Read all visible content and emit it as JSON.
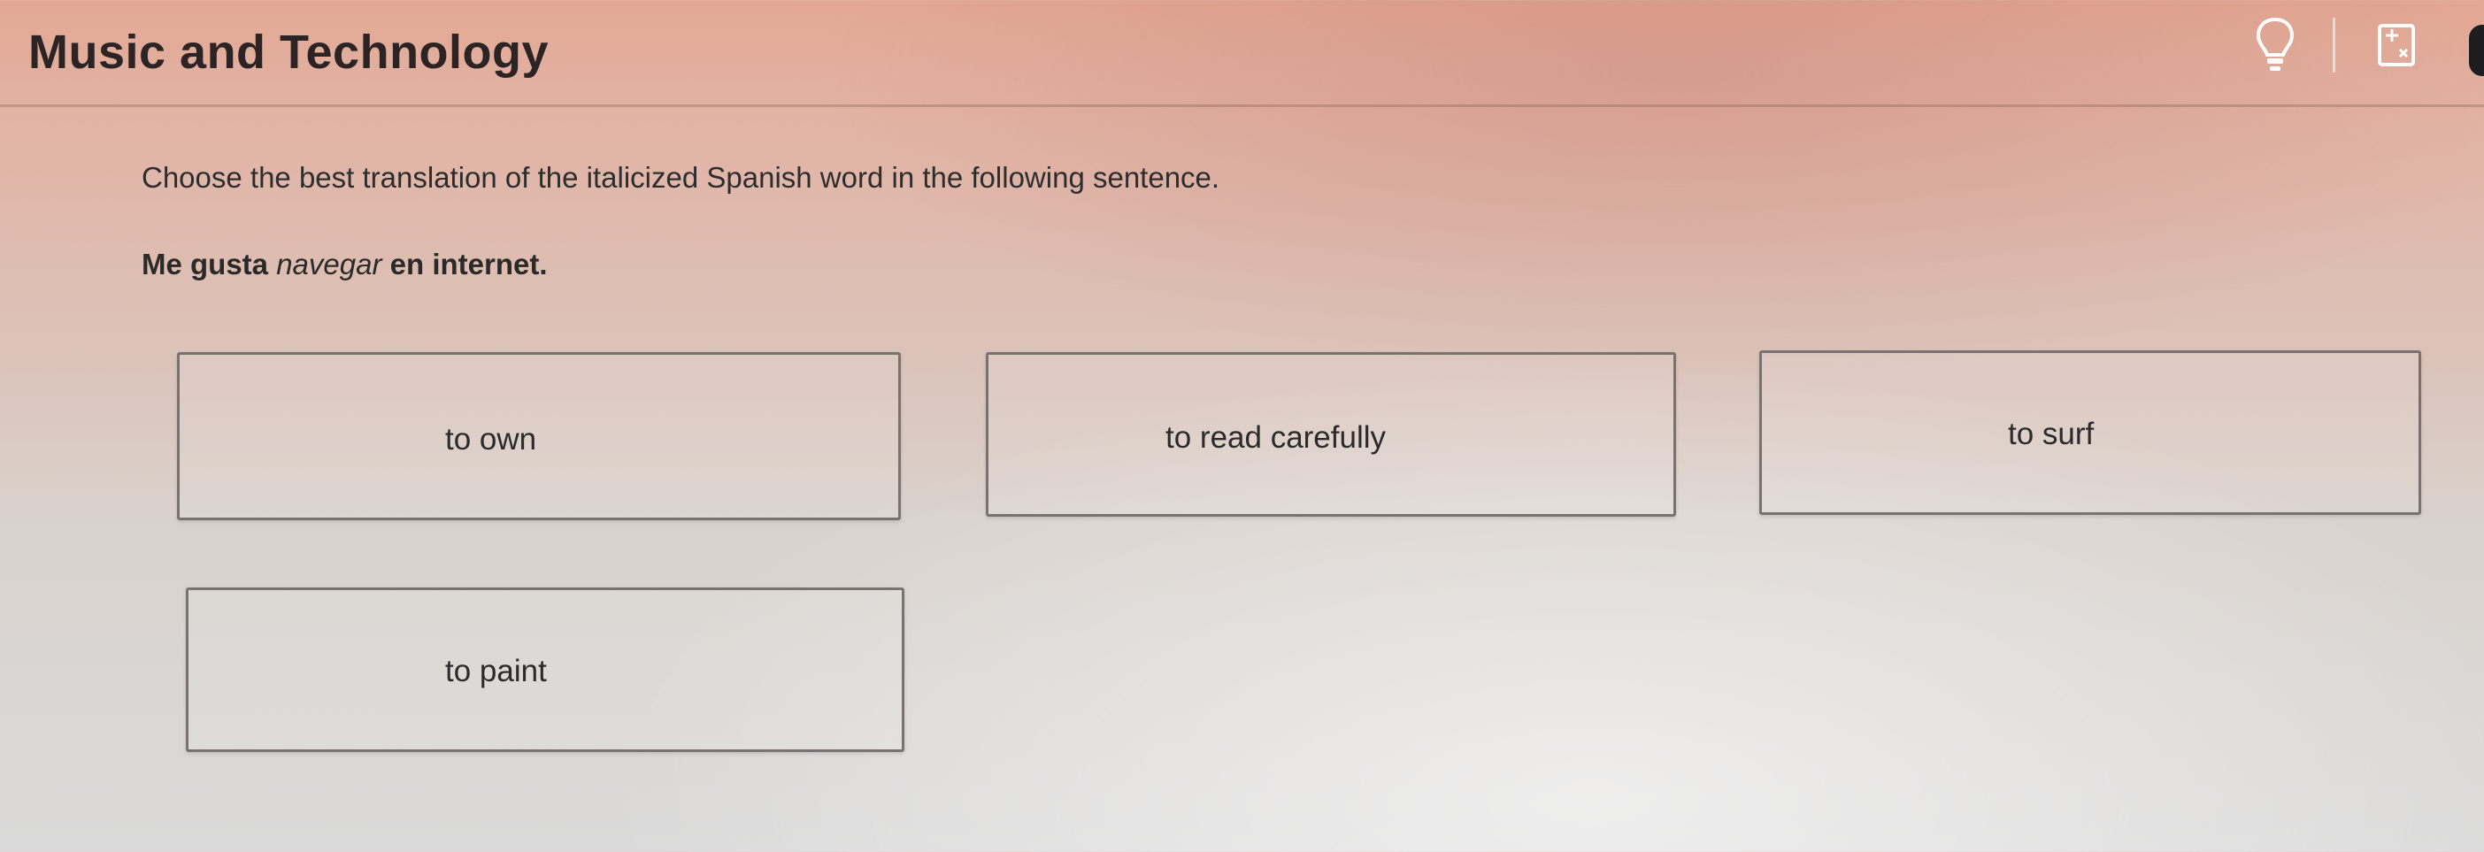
{
  "header": {
    "title": "Music and Technology",
    "icons": [
      "lightbulb-hint-icon",
      "calculator-icon"
    ]
  },
  "question": {
    "instruction": "Choose the best translation of the italicized Spanish word in the following sentence.",
    "sentence_before": "Me gusta ",
    "sentence_italic": "navegar",
    "sentence_after": " en internet."
  },
  "options": [
    {
      "label": "to own"
    },
    {
      "label": "to read carefully"
    },
    {
      "label": "to surf"
    },
    {
      "label": "to paint"
    }
  ],
  "colors": {
    "header_bg": "#e3a894",
    "option_border": "#7a7270",
    "text": "#2a2a2a"
  }
}
